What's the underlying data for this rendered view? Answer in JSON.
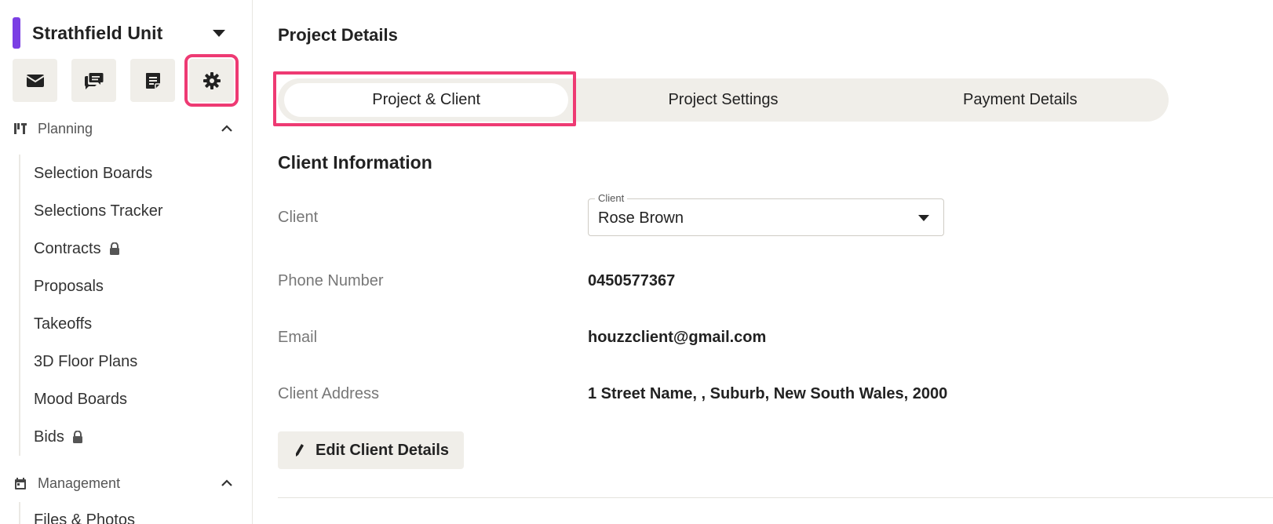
{
  "colors": {
    "accent_project": "#7b3fe4",
    "highlight": "#ee3a73",
    "button_bg": "#f0eee9"
  },
  "sidebar": {
    "project_name": "Strathfield Unit",
    "icon_buttons": [
      {
        "icon": "mail-icon"
      },
      {
        "icon": "chat-icon"
      },
      {
        "icon": "note-icon"
      },
      {
        "icon": "gear-icon"
      }
    ],
    "planning": {
      "label": "Planning",
      "items": [
        {
          "label": "Selection Boards",
          "locked": false
        },
        {
          "label": "Selections Tracker",
          "locked": false
        },
        {
          "label": "Contracts",
          "locked": true
        },
        {
          "label": "Proposals",
          "locked": false
        },
        {
          "label": "Takeoffs",
          "locked": false
        },
        {
          "label": "3D Floor Plans",
          "locked": false
        },
        {
          "label": "Mood Boards",
          "locked": false
        },
        {
          "label": "Bids",
          "locked": true
        }
      ]
    },
    "management": {
      "label": "Management",
      "items": [
        {
          "label": "Files & Photos"
        }
      ]
    }
  },
  "main": {
    "title": "Project Details",
    "tabs": [
      {
        "label": "Project & Client",
        "active": true
      },
      {
        "label": "Project Settings",
        "active": false
      },
      {
        "label": "Payment Details",
        "active": false
      }
    ],
    "client_info": {
      "section_title": "Client Information",
      "client_label": "Client",
      "client_select_legend": "Client",
      "client_select_value": "Rose Brown",
      "phone_label": "Phone Number",
      "phone_value": "0450577367",
      "email_label": "Email",
      "email_value": "houzzclient@gmail.com",
      "address_label": "Client Address",
      "address_value": "1 Street Name, , Suburb, New South Wales, 2000",
      "edit_button_label": "Edit Client Details"
    }
  }
}
